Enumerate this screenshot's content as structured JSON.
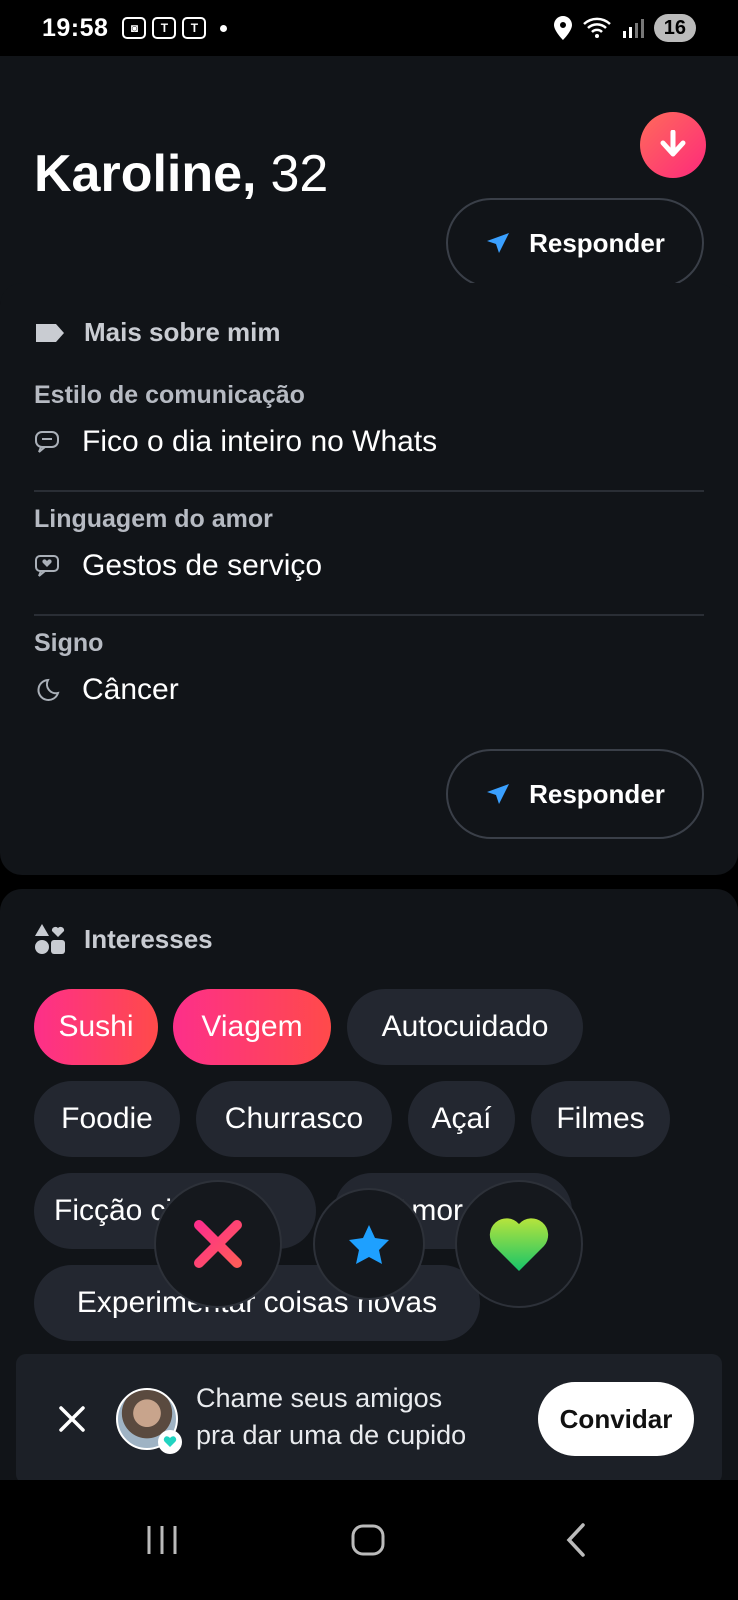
{
  "status_bar": {
    "time": "19:58",
    "battery": "16"
  },
  "profile": {
    "name": "Karoline,",
    "age": "32"
  },
  "top_card": {
    "reply_label": "Responder"
  },
  "about": {
    "title": "Mais sobre mim",
    "items": [
      {
        "label": "Estilo de comunicação",
        "value": "Fico o dia inteiro no Whats",
        "icon": "chat-bubble-icon"
      },
      {
        "label": "Linguagem do amor",
        "value": "Gestos de serviço",
        "icon": "heart-message-icon"
      },
      {
        "label": "Signo",
        "value": "Câncer",
        "icon": "moon-icon"
      }
    ],
    "reply_label": "Responder"
  },
  "interests": {
    "title": "Interesses",
    "chips": [
      "Sushi",
      "Viagem",
      "Autocuidado",
      "Foodie",
      "Churrasco",
      "Açaí",
      "Filmes",
      "Ficção",
      "científica",
      "Amor por",
      "Experimentar coisas novas"
    ],
    "chips_visible_text": [
      "Sushi",
      "Viagem",
      "Autocuidado",
      "Foodie",
      "Churrasco",
      "Açaí",
      "Filmes",
      "Ficção",
      "a",
      "or p",
      "Experimentar coisas novas"
    ]
  },
  "actions": {
    "nope": "x-icon",
    "super_like": "star-icon",
    "like": "heart-icon"
  },
  "invite": {
    "line1": "Chame seus amigos",
    "line2": "pra dar uma de cupido",
    "button": "Convidar"
  },
  "colors": {
    "accent_gradient_start": "#fd2f8a",
    "accent_gradient_end": "#ff4a4a",
    "card_bg": "#111418",
    "chip_bg": "#232730",
    "reply_icon": "#3aa0ff",
    "like_green": "#4cd964",
    "star_blue": "#1ea0ff"
  }
}
